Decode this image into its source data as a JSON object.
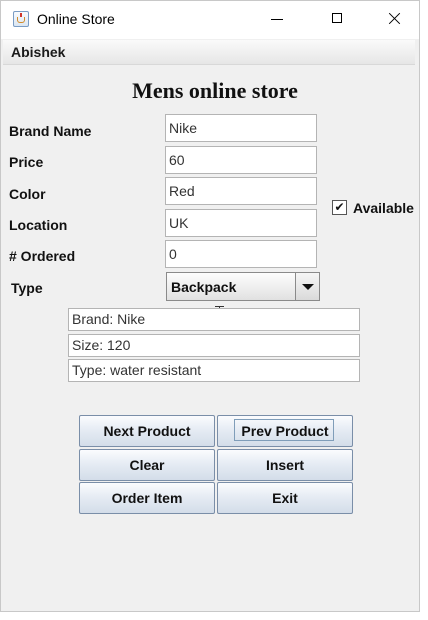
{
  "window": {
    "title": "Online Store"
  },
  "menubar": {
    "label": "Abishek"
  },
  "heading": "Mens online store",
  "form": {
    "brand": {
      "label": "Brand Name",
      "value": "Nike"
    },
    "price": {
      "label": "Price",
      "value": "60"
    },
    "color": {
      "label": "Color",
      "value": "Red"
    },
    "location": {
      "label": "Location",
      "value": "UK"
    },
    "ordered": {
      "label": "# Ordered",
      "value": "0"
    },
    "type": {
      "label": "Type",
      "selected": "Backpack"
    },
    "available": {
      "label": "Available",
      "checked": true,
      "mark": "✔"
    }
  },
  "info": {
    "brand": "Brand: Nike",
    "size": "Size: 120",
    "type": "Type: water resistant"
  },
  "buttons": {
    "next": "Next Product",
    "prev": "Prev Product",
    "clear": "Clear",
    "insert": "Insert",
    "order": "Order Item",
    "exit": "Exit"
  },
  "colors": {
    "window_bg": "#f0f0f0",
    "button_border": "#7a8ea8",
    "field_border": "#b4b4b4"
  }
}
